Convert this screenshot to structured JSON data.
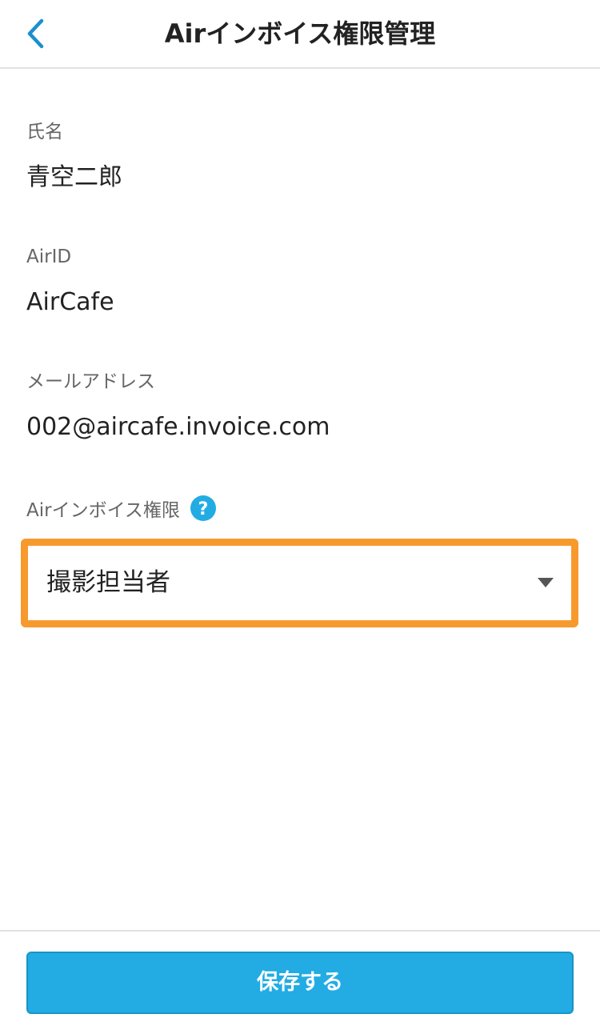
{
  "header": {
    "title": "Airインボイス権限管理",
    "back_icon": "chevron-left-icon"
  },
  "fields": {
    "name": {
      "label": "氏名",
      "value": "青空二郎"
    },
    "airid": {
      "label": "AirID",
      "value": "AirCafe"
    },
    "email": {
      "label": "メールアドレス",
      "value": "002@aircafe.invoice.com"
    }
  },
  "role": {
    "label": "Airインボイス権限",
    "help_icon": "question-circle-icon",
    "selected": "撮影担当者"
  },
  "footer": {
    "save_label": "保存する"
  },
  "colors": {
    "accent": "#22ace3",
    "highlight": "#f79a2e",
    "back_icon": "#1a8fd0"
  }
}
